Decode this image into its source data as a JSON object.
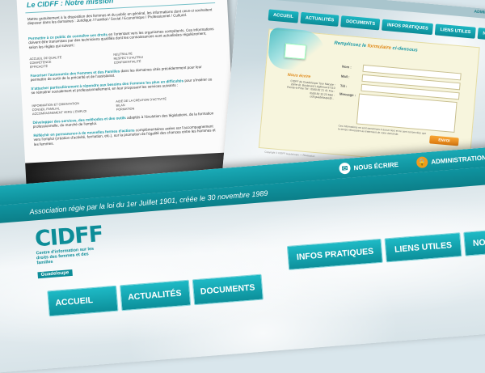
{
  "mission": {
    "heading": "Le CIDFF : Notre mission",
    "p1": "Mettre gratuitement à la disposition des femmes et du public en général, les informations dont ceux-ci souhaitent disposer dans les domaines : Juridique / Familial / Social / Economique / Professionnel / Culturel.",
    "p2_lead": "Permettre à ce public de connaître ses droits",
    "p2": "en l'orientant vers les organismes compétents. Ces informations doivent être transmises par des techniciens qualifiés dont les connaissances sont actualisées régulièrement, selon les règles qui suivent :",
    "rules": [
      "ACCUEIL DE QUALITÉ",
      "NEUTRALITÉ",
      "COMPÉTENCE",
      "RESPECT D'AUTRUI",
      "EFFICACITÉ",
      "CONFIDENTIALITÉ"
    ],
    "p3_lead": "Favoriser l'autonomie des Femmes et des Familles",
    "p3": "dans les domaines cités précédemment pour leur permettre de sortir de la précarité et de l'assistanat.",
    "p4_lead": "S'attacher particulièrement à répondre aux besoins des Femmes les plus en difficultés",
    "p4": "pour s'insérer ou se réinsérer socialement et professionnellement, en leur proposant les services suivants :",
    "services": [
      "INFORMATION ET ORIENTATION",
      "AIDE DE LA CRÉATION D'ACTIVITÉ",
      "CONSEIL FAMILIAL",
      "BILAN",
      "ACCOMPAGNEMENT VERS L'EMPLOI",
      "FORMATION"
    ],
    "p5_lead": "Développer des services, des méthodes et des outils",
    "p5": "adaptés à l'évolution des législations, de la formation professionnelle, du marché de l'emploi.",
    "p6_lead": "Réfléchir en permanence à de nouvelles formes d'actions",
    "p6": "complémentaires axées sur l'accompagnement vers l'emploi (création d'activité, formation, etc.), sur la promotion de l'égalité des chances entre les hommes et les femmes."
  },
  "contact": {
    "top_right": "ADMINISTRATION",
    "nav": [
      "ACCUEIL",
      "ACTUALITÉS",
      "DOCUMENTS",
      "INFOS PRATIQUES",
      "LIENS UTILES",
      "NOUS CONTACTER"
    ],
    "form_title_a": "Remplissez le",
    "form_title_b": "formulaire",
    "form_title_c": "ci-dessous",
    "address_title": "Nous écrire",
    "address": "CIDFF de Guadeloupe Tour Maryse - 2ème ét. Boulevard Légitimus 97110 Pointe-à-Pitre Tél : 0590 82 21 41 Fax : 0590 82 33 23 Mail : cidf.guadeloupe@...",
    "fields": [
      "Nom :",
      "Mail :",
      "Tél :",
      "Message :"
    ],
    "notice": "Ces informations ne sont transmises à aucun tiers et ne sont conservées que le temps nécessaire au traitement de votre demande.",
    "send_label": "ENVOI",
    "footer": "Copyright © CIDFF Guadeloupe — Réalisation"
  },
  "home": {
    "top_write": "NOUS ÉCRIRE",
    "top_admin": "ADMINISTRATION",
    "tagline": "Association régie par la loi du 1er Juillet 1901, créée le 30 novembre 1989",
    "logo_mark": "CIDFF",
    "logo_desc": "Centre d'information sur les droits des femmes et des familles",
    "logo_region": "Guadeloupe",
    "nav_row1": [
      "INFOS PRATIQUES",
      "LIENS UTILES",
      "NOUS CONTACTER"
    ],
    "nav_row2": [
      "ACCUEIL",
      "ACTUALITÉS",
      "DOCUMENTS"
    ]
  },
  "colors": {
    "teal": "#0d8d98",
    "teal_light": "#1ebac6",
    "orange": "#f29a1f"
  }
}
